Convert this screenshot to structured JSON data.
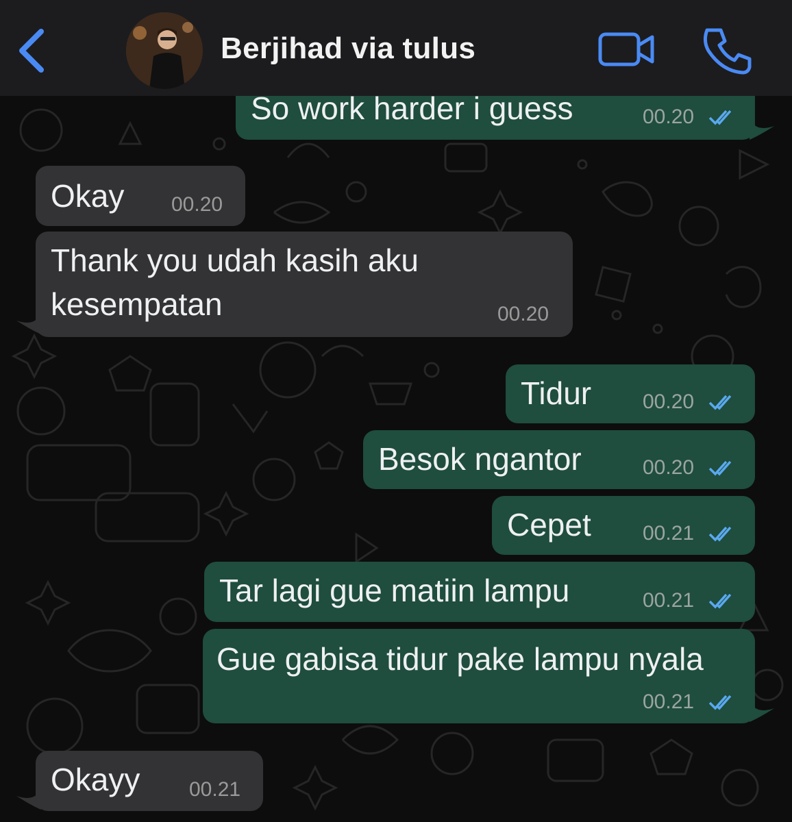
{
  "header": {
    "contact_name": "Berjihad via tulus",
    "back_icon": "chevron-left-icon",
    "video_icon": "video-camera-icon",
    "call_icon": "phone-icon",
    "accent_color": "#4a8af4"
  },
  "messages": [
    {
      "direction": "outgoing",
      "text": "So work harder i guess",
      "time": "00.20",
      "status": "read"
    },
    {
      "direction": "incoming",
      "text": "Okay",
      "time": "00.20"
    },
    {
      "direction": "incoming",
      "text": "Thank you udah kasih aku",
      "text2": "kesempatan",
      "time": "00.20"
    },
    {
      "direction": "outgoing",
      "text": "Tidur",
      "time": "00.20",
      "status": "read"
    },
    {
      "direction": "outgoing",
      "text": "Besok ngantor",
      "time": "00.20",
      "status": "read"
    },
    {
      "direction": "outgoing",
      "text": "Cepet",
      "time": "00.21",
      "status": "read"
    },
    {
      "direction": "outgoing",
      "text": "Tar lagi gue matiin lampu",
      "time": "00.21",
      "status": "read"
    },
    {
      "direction": "outgoing",
      "text": "Gue gabisa tidur pake lampu nyala",
      "time": "00.21",
      "status": "read"
    },
    {
      "direction": "incoming",
      "text": "Okayy",
      "time": "00.21"
    }
  ],
  "colors": {
    "outgoing_bubble": "#1f4d3e",
    "incoming_bubble": "#333335",
    "read_ticks": "#5aa9f0"
  }
}
